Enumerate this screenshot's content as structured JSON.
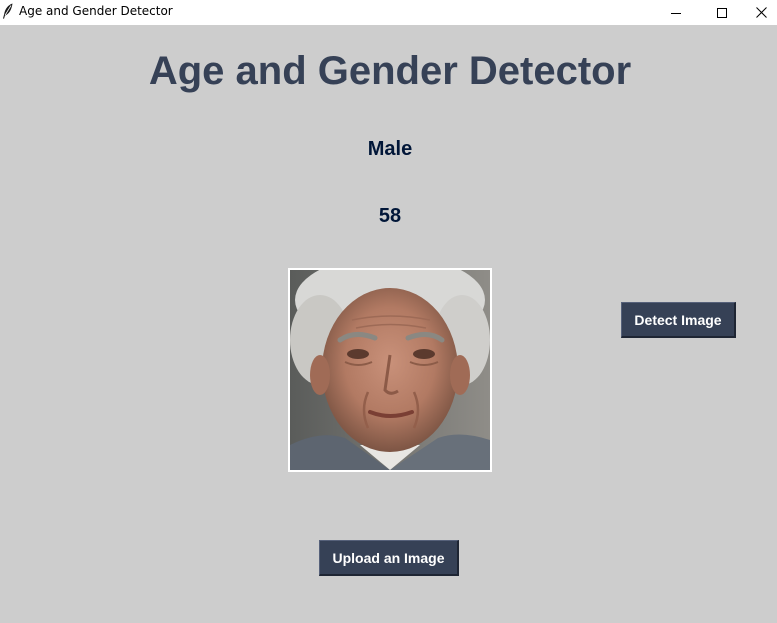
{
  "window": {
    "title": "Age and Gender Detector",
    "icon": "feather-icon",
    "controls": {
      "minimize_icon": "minimize-icon",
      "maximize_icon": "maximize-icon",
      "close_icon": "close-icon"
    }
  },
  "main": {
    "heading": "Age and Gender Detector",
    "gender": "Male",
    "age": "58",
    "photo_description_icon": "face-photo",
    "detect_button_label": "Detect Image",
    "upload_button_label": "Upload an Image"
  },
  "colors": {
    "background": "#cdcdcd",
    "heading": "#364156",
    "result_text": "#011638",
    "button_bg": "#364156",
    "button_text": "#ffffff"
  }
}
